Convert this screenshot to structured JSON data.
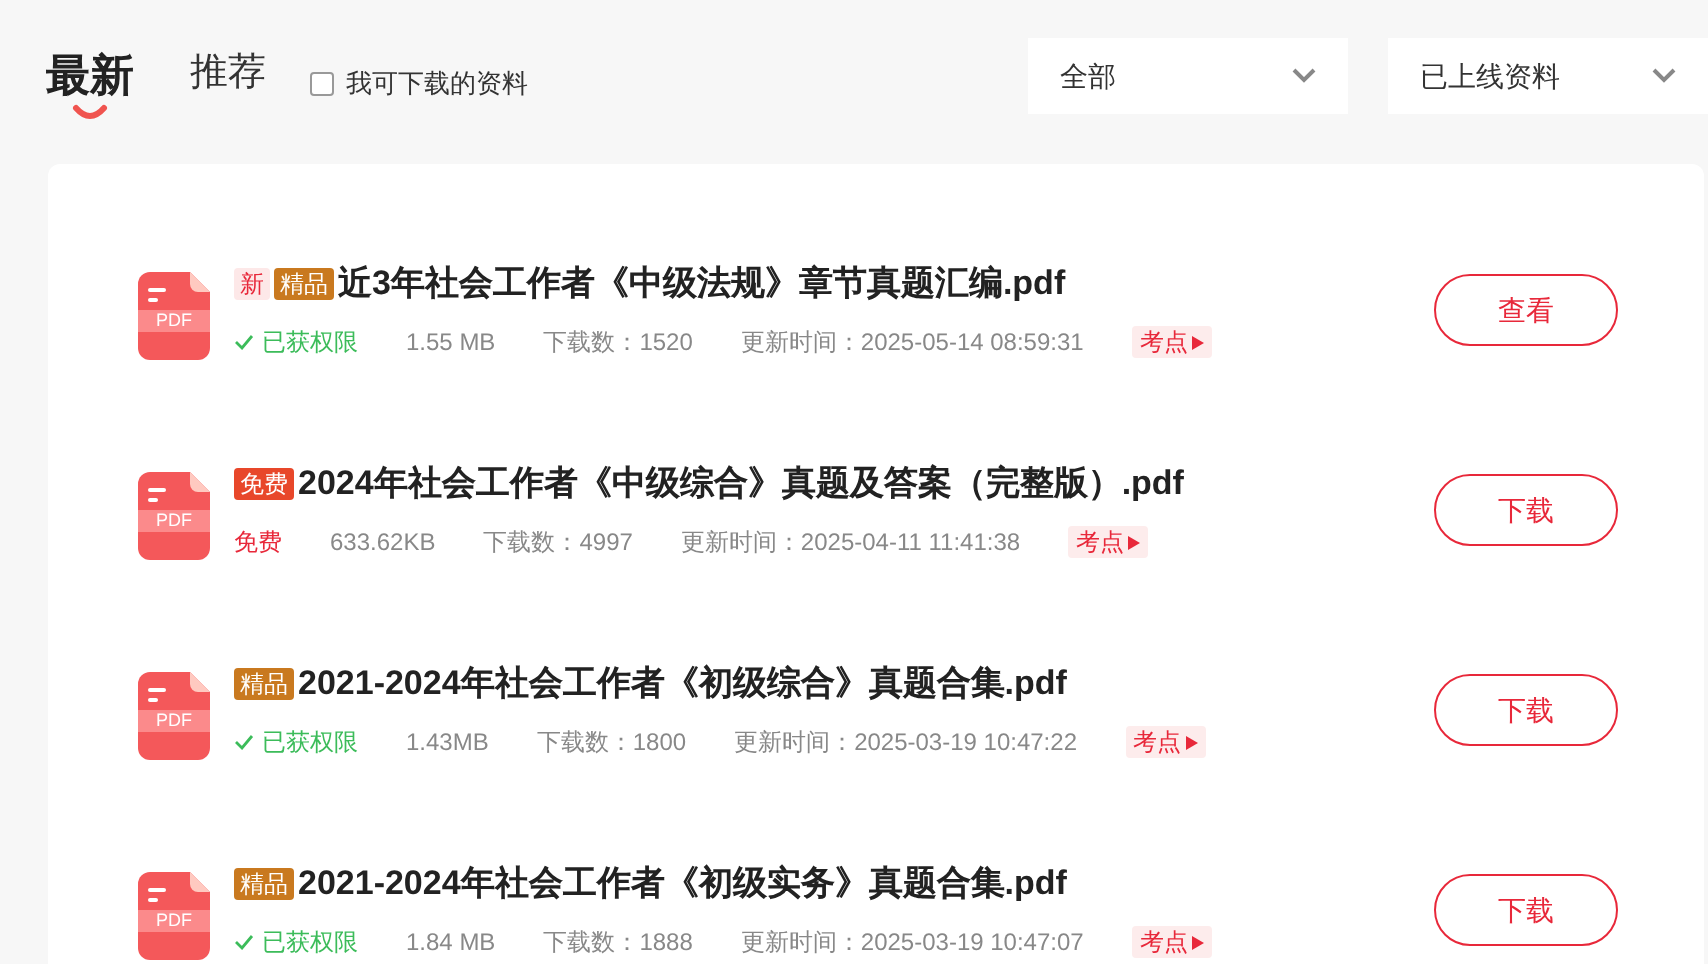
{
  "tabs": [
    {
      "label": "最新",
      "selected": true
    },
    {
      "label": "推荐",
      "selected": false
    }
  ],
  "filter_checkbox": {
    "label": "我可下载的资料",
    "checked": false
  },
  "dropdowns": [
    {
      "value": "全部"
    },
    {
      "value": "已上线资料"
    }
  ],
  "files": [
    {
      "tags": [
        {
          "kind": "new",
          "text": "新"
        },
        {
          "kind": "premium",
          "text": "精品"
        }
      ],
      "file_type": "PDF",
      "title": "近3年社会工作者《中级法规》章节真题汇编.pdf",
      "access": {
        "kind": "granted",
        "text": "已获权限"
      },
      "size": "1.55 MB",
      "downloads": "下载数：1520",
      "updated": "更新时间：2025-05-14 08:59:31",
      "topic": "考点",
      "action": "查看"
    },
    {
      "tags": [
        {
          "kind": "free",
          "text": "免费"
        }
      ],
      "file_type": "PDF",
      "title": "2024年社会工作者《中级综合》真题及答案（完整版）.pdf",
      "access": {
        "kind": "free",
        "text": "免费"
      },
      "size": "633.62KB",
      "downloads": "下载数：4997",
      "updated": "更新时间：2025-04-11 11:41:38",
      "topic": "考点",
      "action": "下载"
    },
    {
      "tags": [
        {
          "kind": "premium",
          "text": "精品"
        }
      ],
      "file_type": "PDF",
      "title": "2021-2024年社会工作者《初级综合》真题合集.pdf",
      "access": {
        "kind": "granted",
        "text": "已获权限"
      },
      "size": "1.43MB",
      "downloads": "下载数：1800",
      "updated": "更新时间：2025-03-19 10:47:22",
      "topic": "考点",
      "action": "下载"
    },
    {
      "tags": [
        {
          "kind": "premium",
          "text": "精品"
        }
      ],
      "file_type": "PDF",
      "title": "2021-2024年社会工作者《初级实务》真题合集.pdf",
      "access": {
        "kind": "granted",
        "text": "已获权限"
      },
      "size": "1.84 MB",
      "downloads": "下载数：1888",
      "updated": "更新时间：2025-03-19 10:47:07",
      "topic": "考点",
      "action": "下载"
    }
  ]
}
